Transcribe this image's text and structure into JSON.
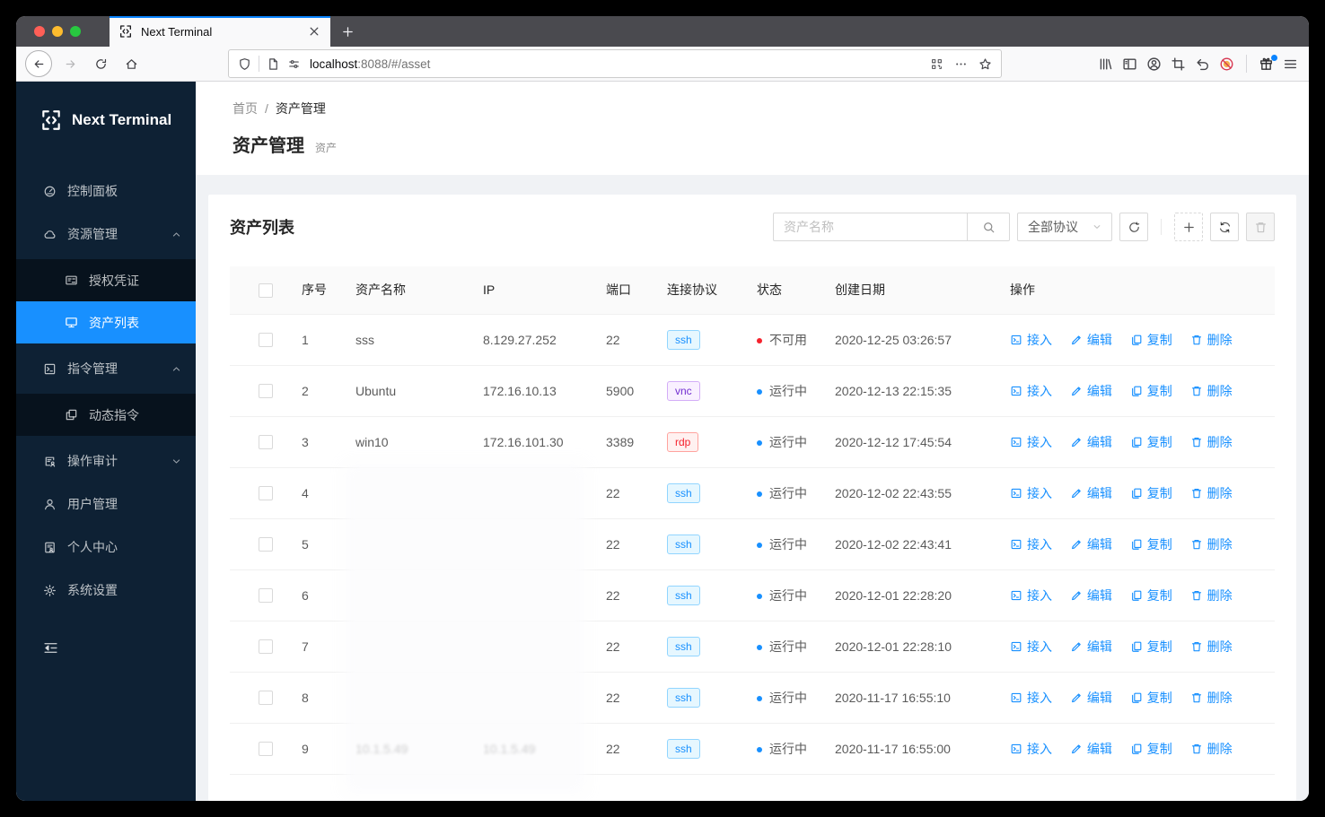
{
  "browser": {
    "traffic_lights": [
      "#ff5f57",
      "#febc2e",
      "#28c840"
    ],
    "tab_title": "Next Terminal",
    "url_host": "localhost",
    "url_path": ":8088/#/asset"
  },
  "sidebar": {
    "logo_text": "Next Terminal",
    "items": [
      {
        "id": "dashboard",
        "icon": "dashboard-icon",
        "label": "控制面板",
        "type": "top"
      },
      {
        "id": "resources",
        "icon": "cloud-icon",
        "label": "资源管理",
        "type": "top",
        "chevron": "up"
      },
      {
        "id": "credentials",
        "icon": "idcard-icon",
        "label": "授权凭证",
        "type": "sub"
      },
      {
        "id": "assets",
        "icon": "desktop-icon",
        "label": "资产列表",
        "type": "sub",
        "active": true
      },
      {
        "id": "commands",
        "icon": "code-icon",
        "label": "指令管理",
        "type": "top",
        "chevron": "up"
      },
      {
        "id": "dynamic-commands",
        "icon": "block-icon",
        "label": "动态指令",
        "type": "sub"
      },
      {
        "id": "audit",
        "icon": "audit-icon",
        "label": "操作审计",
        "type": "top",
        "chevron": "down"
      },
      {
        "id": "users",
        "icon": "user-icon",
        "label": "用户管理",
        "type": "top"
      },
      {
        "id": "profile",
        "icon": "solution-icon",
        "label": "个人中心",
        "type": "top"
      },
      {
        "id": "settings",
        "icon": "setting-icon",
        "label": "系统设置",
        "type": "top"
      }
    ]
  },
  "page": {
    "breadcrumb_home": "首页",
    "breadcrumb_sep": "/",
    "breadcrumb_current": "资产管理",
    "title": "资产管理",
    "subtitle": "资产",
    "card_title": "资产列表",
    "search_placeholder": "资产名称",
    "protocol_filter": "全部协议"
  },
  "table": {
    "columns": [
      "序号",
      "资产名称",
      "IP",
      "端口",
      "连接协议",
      "状态",
      "创建日期",
      "操作"
    ],
    "action_labels": [
      "接入",
      "编辑",
      "复制",
      "删除"
    ],
    "rows": [
      {
        "index": "1",
        "name": "sss",
        "ip": "8.129.27.252",
        "port": "22",
        "protocol": "ssh",
        "status": "不可用",
        "status_type": "error",
        "created": "2020-12-25 03:26:57"
      },
      {
        "index": "2",
        "name": "Ubuntu",
        "ip": "172.16.10.13",
        "port": "5900",
        "protocol": "vnc",
        "status": "运行中",
        "status_type": "processing",
        "created": "2020-12-13 22:15:35"
      },
      {
        "index": "3",
        "name": "win10",
        "ip": "172.16.101.30",
        "port": "3389",
        "protocol": "rdp",
        "status": "运行中",
        "status_type": "processing",
        "created": "2020-12-12 17:45:54"
      },
      {
        "index": "4",
        "name": "",
        "ip": "",
        "port": "22",
        "protocol": "ssh",
        "status": "运行中",
        "status_type": "processing",
        "created": "2020-12-02 22:43:55",
        "redacted": true
      },
      {
        "index": "5",
        "name": "",
        "ip": "",
        "port": "22",
        "protocol": "ssh",
        "status": "运行中",
        "status_type": "processing",
        "created": "2020-12-02 22:43:41",
        "redacted": true
      },
      {
        "index": "6",
        "name": "",
        "ip": "",
        "port": "22",
        "protocol": "ssh",
        "status": "运行中",
        "status_type": "processing",
        "created": "2020-12-01 22:28:20",
        "redacted": true
      },
      {
        "index": "7",
        "name": "",
        "ip": "",
        "port": "22",
        "protocol": "ssh",
        "status": "运行中",
        "status_type": "processing",
        "created": "2020-12-01 22:28:10",
        "redacted": true
      },
      {
        "index": "8",
        "name": "",
        "ip": "",
        "port": "22",
        "protocol": "ssh",
        "status": "运行中",
        "status_type": "processing",
        "created": "2020-11-17 16:55:10",
        "redacted": true
      },
      {
        "index": "9",
        "name": "10.1.5.49",
        "ip": "10.1.5.49",
        "port": "22",
        "protocol": "ssh",
        "status": "运行中",
        "status_type": "processing",
        "created": "2020-11-17 16:55:00",
        "redacted": true
      }
    ]
  },
  "colors": {
    "primary": "#1890ff",
    "sidebar_active": "#1890ff",
    "status": {
      "error": "#f5222d",
      "processing": "#1890ff"
    },
    "protocols": {
      "ssh": {
        "text": "#1890ff",
        "bg": "#e6f7ff",
        "border": "#91d5ff"
      },
      "vnc": {
        "text": "#722ed1",
        "bg": "#f9f0ff",
        "border": "#d3adf7"
      },
      "rdp": {
        "text": "#f5222d",
        "bg": "#fff1f0",
        "border": "#ffa39e"
      }
    }
  }
}
